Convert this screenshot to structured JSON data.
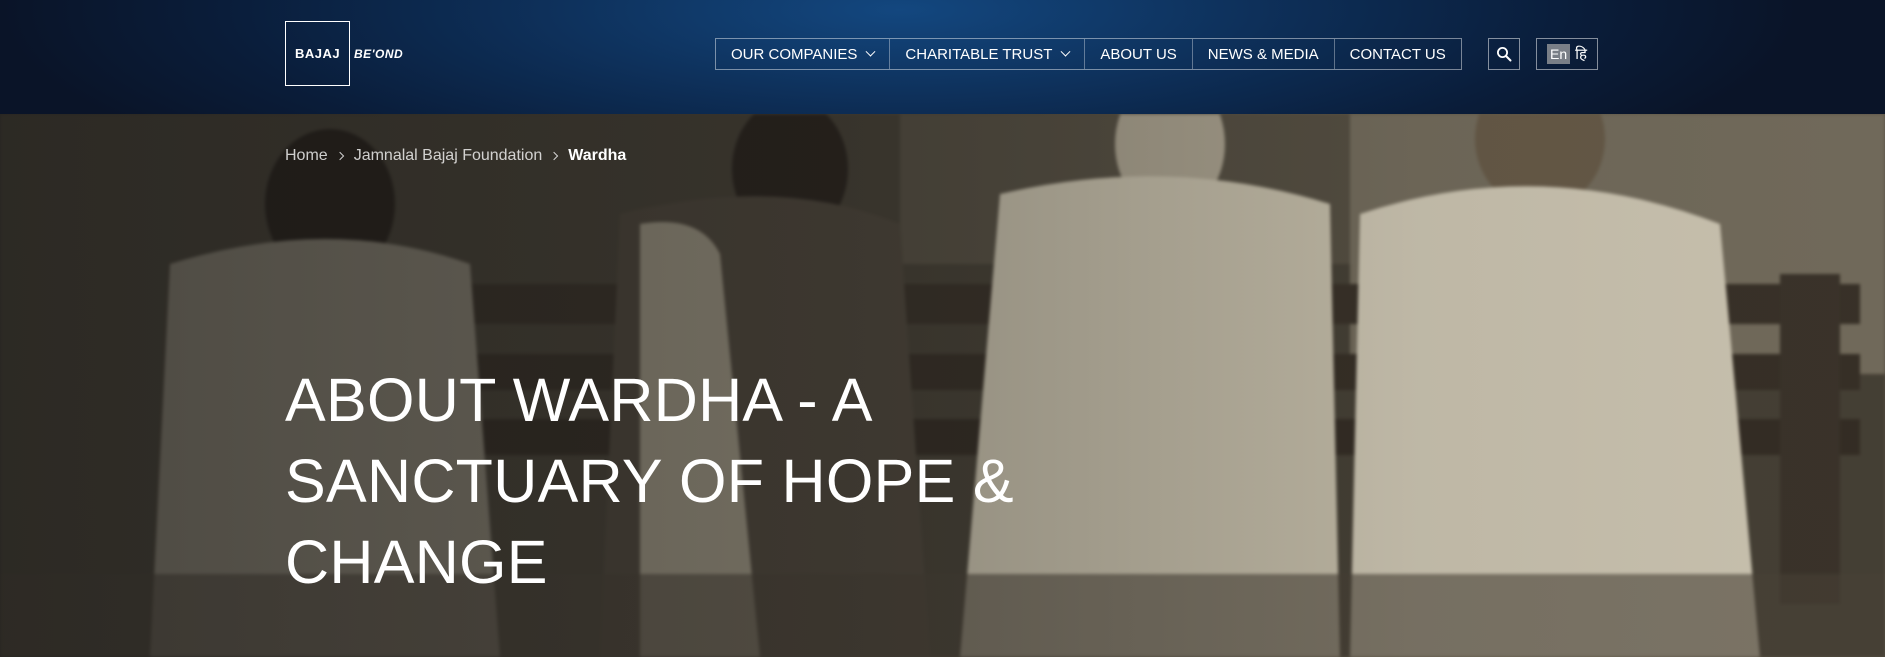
{
  "header": {
    "logo_text": "BAJAJ",
    "logo_tagline": "BE'OND",
    "nav": [
      {
        "label": "OUR COMPANIES",
        "has_dropdown": true
      },
      {
        "label": "CHARITABLE TRUST",
        "has_dropdown": true
      },
      {
        "label": "ABOUT US",
        "has_dropdown": false
      },
      {
        "label": "NEWS & MEDIA",
        "has_dropdown": false
      },
      {
        "label": "CONTACT US",
        "has_dropdown": false
      }
    ],
    "search_icon": "search-icon",
    "language": {
      "selected": "En",
      "alternate": "हि"
    }
  },
  "breadcrumb": [
    {
      "label": "Home"
    },
    {
      "label": "Jamnalal Bajaj Foundation"
    },
    {
      "label": "Wardha"
    }
  ],
  "hero": {
    "title": "ABOUT WARDHA - A SANCTUARY OF HOPE & CHANGE"
  },
  "colors": {
    "header_bg": "#0d2d55",
    "active_lang_bg": "#7a7f87",
    "text": "#ffffff"
  }
}
